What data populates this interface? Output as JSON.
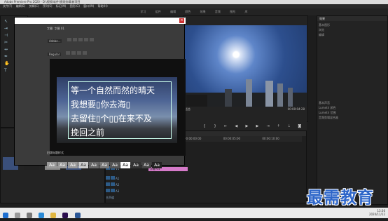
{
  "window": {
    "title": "Adobe Premiere Pro 2020 - D:\\视频\\软件\\视频剪辑\\新项目"
  },
  "menu": [
    "文件(F)",
    "编辑(E)",
    "剪辑(C)",
    "序列(S)",
    "标记(M)",
    "图形(G)",
    "窗口(W)",
    "帮助(H)"
  ],
  "workspaces": [
    "学习",
    "组件",
    "编辑",
    "颜色",
    "效果",
    "音频",
    "图形",
    "库"
  ],
  "dialog": {
    "tab_title": "字幕: 字幕 01",
    "font": "Adobe...",
    "style": "Regular",
    "close": "×"
  },
  "title_text": {
    "lines": [
      "等一个自然而然的晴天",
      "我想要▯你去海▯",
      "去留住▯个▯▯在来不及",
      "挽回之前"
    ]
  },
  "title_styles": {
    "label": "旧版标题样式",
    "samples": [
      "Aa",
      "Aa",
      "Aa",
      "Aa",
      "Aa",
      "Aa",
      "Aa",
      "Aa",
      "Aa",
      "Aa",
      "Aa"
    ]
  },
  "program": {
    "tc_left": "00:00:00:00",
    "fit": "适合",
    "tc_right": "00:00:04:28"
  },
  "timeline": {
    "ticks": [
      "00:00:00:00",
      "00:00:05:00",
      "00:00:10:00"
    ],
    "clip_label": "字幕 01",
    "tracks": [
      "V3",
      "V2",
      "V1",
      "A1",
      "A2",
      "A3",
      "主声道"
    ]
  },
  "right_panel": {
    "header": "效果",
    "tabs": [
      "基本图形",
      "浏览",
      "编辑"
    ],
    "items": [
      "基本声音",
      "Lumetri 颜色",
      "Lumetri 范围",
      "音频剪辑混合器"
    ]
  },
  "taskbar": {
    "time": "13:36",
    "date": "2020/11/12"
  },
  "watermark": "最需教育",
  "colors": {
    "clip": "#d57ac9",
    "accent": "#2e66c9"
  }
}
